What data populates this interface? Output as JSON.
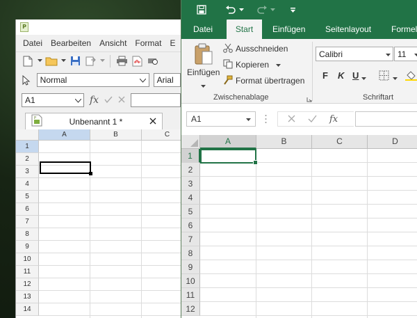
{
  "libreoffice": {
    "menu": [
      "Datei",
      "Bearbeiten",
      "Ansicht",
      "Format",
      "E"
    ],
    "style_value": "Normal",
    "font_value": "Arial",
    "namebox_value": "A1",
    "doc_tab_title": "Unbenannt 1 *",
    "columns": [
      "A",
      "B",
      "C"
    ],
    "rows": [
      "1",
      "2",
      "3",
      "4",
      "5",
      "6",
      "7",
      "8",
      "9",
      "10",
      "11",
      "12",
      "13",
      "14"
    ]
  },
  "excel": {
    "tabs": [
      "Datei",
      "Start",
      "Einfügen",
      "Seitenlayout",
      "Formeln"
    ],
    "active_tab": "Start",
    "clipboard": {
      "paste_label": "Einfügen",
      "cut_label": "Ausschneiden",
      "copy_label": "Kopieren",
      "format_painter_label": "Format übertragen",
      "group_label": "Zwischenablage"
    },
    "font": {
      "font_name": "Calibri",
      "font_size": "11",
      "bold": "F",
      "italic": "K",
      "underline": "U",
      "group_label": "Schriftart"
    },
    "namebox_value": "A1",
    "columns": [
      "A",
      "B",
      "C",
      "D"
    ],
    "rows": [
      "1",
      "2",
      "3",
      "4",
      "5",
      "6",
      "7",
      "8",
      "9",
      "10",
      "11",
      "12"
    ]
  },
  "colors": {
    "excel_green": "#217346",
    "lo_selection": "#c5d8ef"
  }
}
